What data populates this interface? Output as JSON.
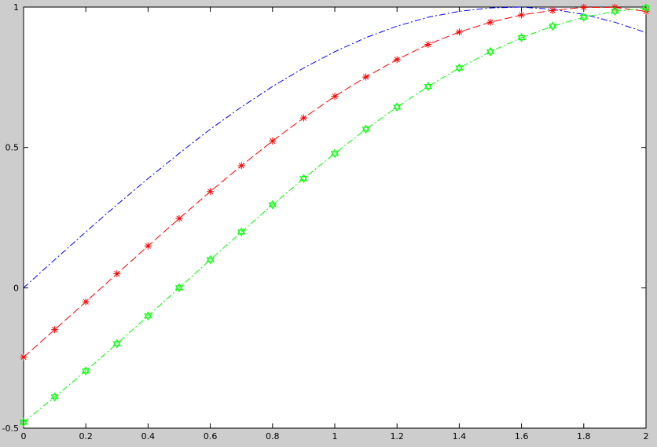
{
  "chart_data": {
    "type": "line",
    "xlim": [
      0,
      2
    ],
    "ylim": [
      -0.5,
      1
    ],
    "xticks": [
      0,
      0.2,
      0.4,
      0.6,
      0.8,
      1,
      1.2,
      1.4,
      1.6,
      1.8,
      2
    ],
    "xtick_labels": [
      "0",
      "0.2",
      "0.4",
      "0.6",
      "0.8",
      "1",
      "1.2",
      "1.4",
      "1.6",
      "1.8",
      "2"
    ],
    "yticks": [
      -0.5,
      0,
      0.5,
      1
    ],
    "ytick_labels": [
      "-0.5",
      "0",
      "0.5",
      "1"
    ],
    "grid": false,
    "series": [
      {
        "color": "#0000ff",
        "line_style": "dash-dot",
        "marker": "none",
        "x": [
          0,
          0.1,
          0.2,
          0.3,
          0.4,
          0.5,
          0.6,
          0.7,
          0.8,
          0.9,
          1,
          1.1,
          1.2,
          1.3,
          1.4,
          1.5,
          1.6,
          1.7,
          1.8,
          1.9,
          2
        ],
        "y": [
          0,
          0.1,
          0.199,
          0.296,
          0.389,
          0.479,
          0.565,
          0.644,
          0.717,
          0.783,
          0.841,
          0.891,
          0.932,
          0.964,
          0.985,
          0.997,
          1.0,
          0.992,
          0.974,
          0.946,
          0.909
        ]
      },
      {
        "color": "#ff0000",
        "line_style": "dashed",
        "marker": "asterisk",
        "x": [
          0,
          0.1,
          0.2,
          0.3,
          0.4,
          0.5,
          0.6,
          0.7,
          0.8,
          0.9,
          1,
          1.1,
          1.2,
          1.3,
          1.4,
          1.5,
          1.6,
          1.7,
          1.8,
          1.9,
          2
        ],
        "y": [
          -0.247,
          -0.149,
          -0.05,
          0.05,
          0.149,
          0.247,
          0.343,
          0.435,
          0.523,
          0.605,
          0.682,
          0.751,
          0.813,
          0.867,
          0.911,
          0.946,
          0.972,
          0.988,
          0.999,
          0.999,
          0.985
        ]
      },
      {
        "color": "#00ff00",
        "line_style": "dash-dot",
        "marker": "hexagram",
        "x": [
          0,
          0.1,
          0.2,
          0.3,
          0.4,
          0.5,
          0.6,
          0.7,
          0.8,
          0.9,
          1,
          1.1,
          1.2,
          1.3,
          1.4,
          1.5,
          1.6,
          1.7,
          1.8,
          1.9,
          2
        ],
        "y": [
          -0.479,
          -0.389,
          -0.296,
          -0.199,
          -0.1,
          0,
          0.1,
          0.199,
          0.296,
          0.389,
          0.479,
          0.565,
          0.644,
          0.717,
          0.783,
          0.841,
          0.891,
          0.932,
          0.964,
          0.985,
          0.997
        ]
      }
    ]
  }
}
